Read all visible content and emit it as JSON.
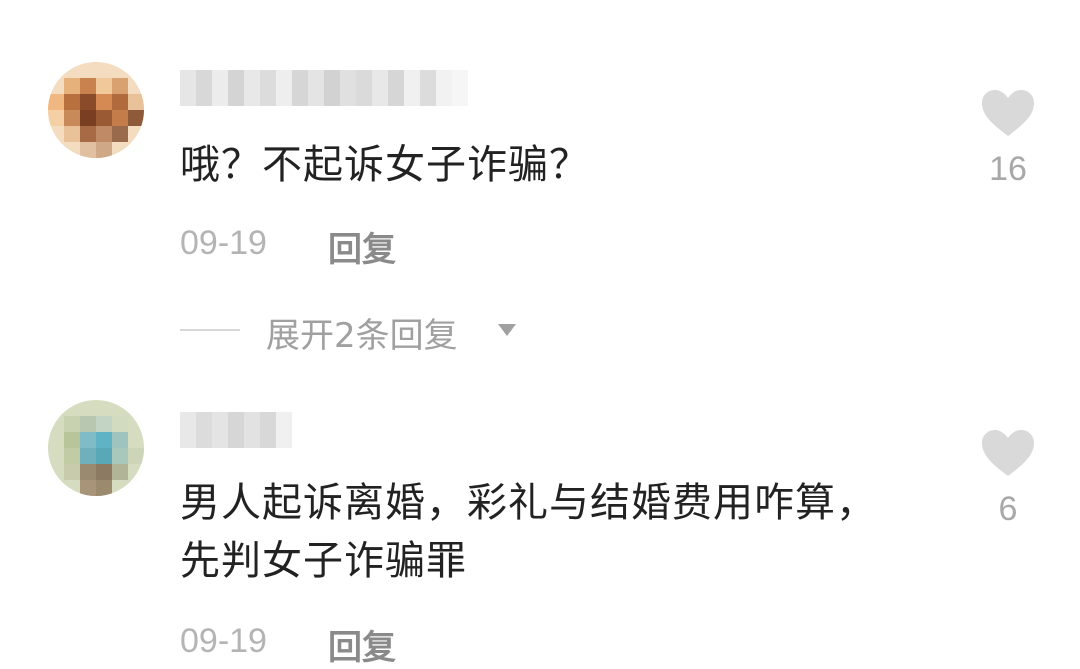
{
  "comments": [
    {
      "text": "哦？不起诉女子诈骗？",
      "date": "09-19",
      "reply_label": "回复",
      "likes": "16",
      "expand_label": "展开2条回复",
      "icons": {
        "like": "heart-icon",
        "expand": "caret-down-icon"
      },
      "avatar_colors": [
        "#f2d7b6",
        "#e0a56a",
        "#b06a3c",
        "#8a4b2a",
        "#d48a52",
        "#f5e3cc"
      ]
    },
    {
      "text": "男人起诉离婚，彩礼与结婚费用咋算，先判女子诈骗罪",
      "date": "09-19",
      "reply_label": "回复",
      "likes": "6",
      "icons": {
        "like": "heart-icon"
      },
      "avatar_colors": [
        "#d6dcc0",
        "#9fc4c0",
        "#5fb3c4",
        "#8c7a62",
        "#b8c49a",
        "#e6e9d6"
      ]
    }
  ],
  "colors": {
    "text": "#222222",
    "meta": "#b4b4b4",
    "reply": "#8a8a8a",
    "heart": "#d9d9d9"
  }
}
